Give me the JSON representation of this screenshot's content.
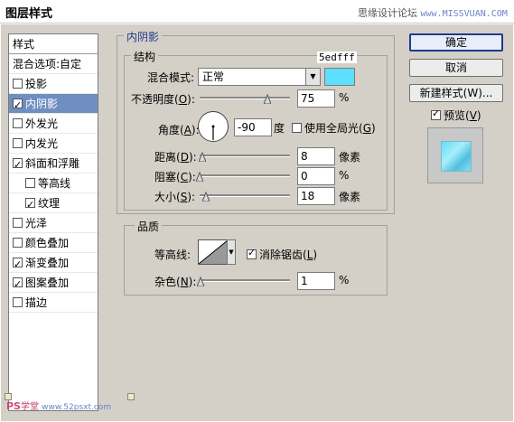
{
  "window": {
    "title": "图层样式",
    "watermark": "思缘设计论坛",
    "watermark_url": "www.MISSVUAN.COM"
  },
  "stylelist": {
    "header": "样式",
    "blend_options": "混合选项:自定",
    "items": [
      {
        "label": "投影",
        "checked": false,
        "selected": false,
        "sub": false
      },
      {
        "label": "内阴影",
        "checked": true,
        "selected": true,
        "sub": false
      },
      {
        "label": "外发光",
        "checked": false,
        "selected": false,
        "sub": false
      },
      {
        "label": "内发光",
        "checked": false,
        "selected": false,
        "sub": false
      },
      {
        "label": "斜面和浮雕",
        "checked": true,
        "selected": false,
        "sub": false
      },
      {
        "label": "等高线",
        "checked": false,
        "selected": false,
        "sub": true
      },
      {
        "label": "纹理",
        "checked": true,
        "selected": false,
        "sub": true
      },
      {
        "label": "光泽",
        "checked": false,
        "selected": false,
        "sub": false
      },
      {
        "label": "颜色叠加",
        "checked": false,
        "selected": false,
        "sub": false
      },
      {
        "label": "渐变叠加",
        "checked": true,
        "selected": false,
        "sub": false
      },
      {
        "label": "图案叠加",
        "checked": true,
        "selected": false,
        "sub": false
      },
      {
        "label": "描边",
        "checked": false,
        "selected": false,
        "sub": false
      }
    ]
  },
  "panel": {
    "title": "内阴影",
    "structure": {
      "title": "结构",
      "color_code": "5edfff",
      "blend_mode_label": "混合模式:",
      "blend_mode_value": "正常",
      "shadow_color": "#5edfff",
      "opacity_label_pre": "不透明度(",
      "opacity_key": "O",
      "opacity_label_post": "):",
      "opacity_value": "75",
      "opacity_fraction": 0.75,
      "opacity_unit": "%",
      "angle_label_pre": "角度(",
      "angle_key": "A",
      "angle_label_post": "):",
      "angle_value": "-90",
      "angle_unit": "度",
      "global_light_pre": "使用全局光(",
      "global_light_key": "G",
      "global_light_post": ")",
      "global_light_checked": false,
      "distance_label_pre": "距离(",
      "distance_key": "D",
      "distance_label_post": "):",
      "distance_value": "8",
      "distance_fraction": 0.03,
      "distance_unit": "像素",
      "choke_label_pre": "阻塞(",
      "choke_key": "C",
      "choke_label_post": "):",
      "choke_value": "0",
      "choke_fraction": 0.0,
      "choke_unit": "%",
      "size_label_pre": "大小(",
      "size_key": "S",
      "size_label_post": "):",
      "size_value": "18",
      "size_fraction": 0.07,
      "size_unit": "像素"
    },
    "quality": {
      "title": "品质",
      "contour_label": "等高线:",
      "antialias_pre": "消除锯齿(",
      "antialias_key": "L",
      "antialias_post": ")",
      "antialias_checked": true,
      "noise_label_pre": "杂色(",
      "noise_key": "N",
      "noise_label_post": "):",
      "noise_value": "1",
      "noise_fraction": 0.01,
      "noise_unit": "%"
    }
  },
  "buttons": {
    "ok": "确定",
    "cancel": "取消",
    "new_style": "新建样式(W)...",
    "preview_label_pre": "预览(",
    "preview_key": "V",
    "preview_label_post": ")",
    "preview_checked": true
  },
  "footer_watermark": {
    "ps": "PS",
    "text": "学堂",
    "url": "www.52psxt.com"
  }
}
